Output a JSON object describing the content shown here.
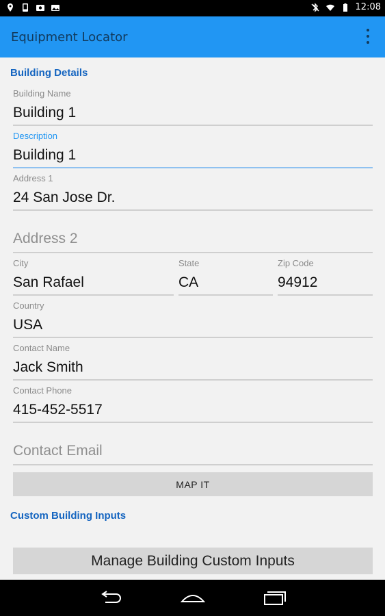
{
  "status_bar": {
    "time": "12:08",
    "left_icons": [
      "location-pin-icon",
      "phone-icon",
      "photo-icon",
      "gallery-icon"
    ],
    "right_icons": [
      "bluetooth-off-icon",
      "wifi-icon",
      "battery-icon"
    ]
  },
  "app_bar": {
    "title": "Equipment Locator",
    "overflow_icon": "more-vert-icon",
    "color": "#2196f3"
  },
  "building_details": {
    "title": "Building Details",
    "building_name": {
      "label": "Building Name",
      "value": "Building 1"
    },
    "description": {
      "label": "Description",
      "value": "Building 1"
    },
    "address1": {
      "label": "Address 1",
      "value": "24 San Jose Dr."
    },
    "address2": {
      "placeholder": "Address 2",
      "value": ""
    },
    "city": {
      "label": "City",
      "value": "San Rafael"
    },
    "state": {
      "label": "State",
      "value": "CA"
    },
    "zip": {
      "label": "Zip Code",
      "value": "94912"
    },
    "country": {
      "label": "Country",
      "value": "USA"
    },
    "contact_name": {
      "label": "Contact Name",
      "value": "Jack Smith"
    },
    "contact_phone": {
      "label": "Contact Phone",
      "value": "415-452-5517"
    },
    "contact_email": {
      "placeholder": "Contact Email",
      "value": ""
    },
    "map_button": "MAP IT"
  },
  "custom_inputs": {
    "title": "Custom Building Inputs",
    "manage_button": "Manage Building Custom Inputs"
  },
  "nav_bar": {
    "buttons": [
      "back-icon",
      "home-icon",
      "recents-icon"
    ]
  }
}
